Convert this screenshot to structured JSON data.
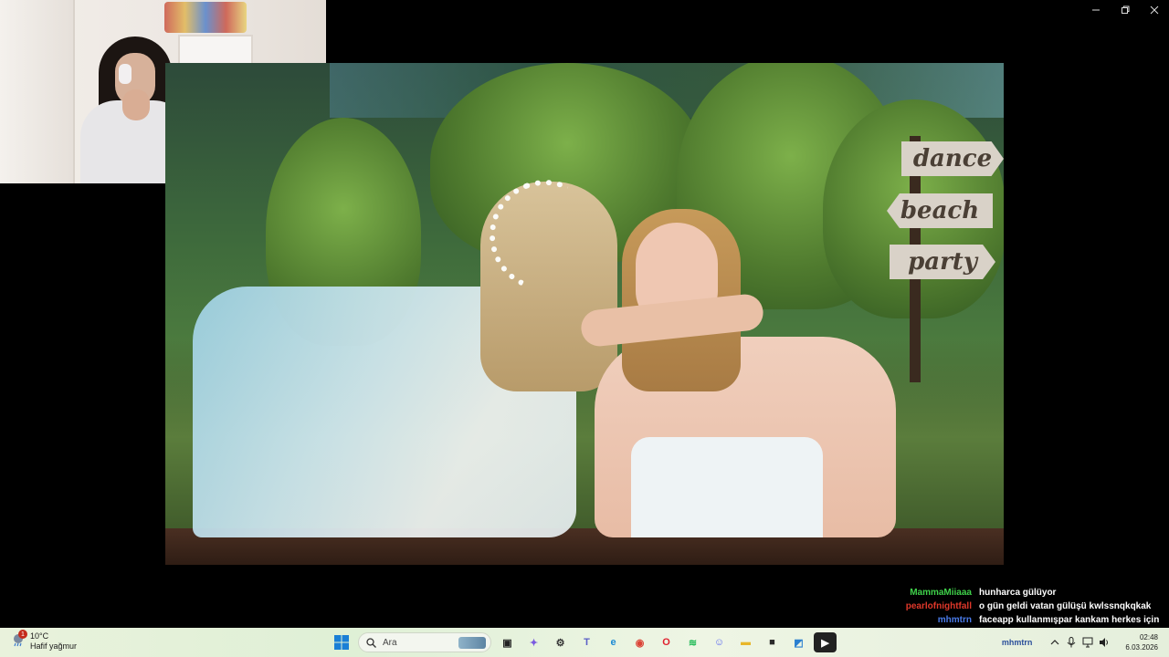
{
  "window": {
    "controls": [
      {
        "name": "minimize-icon"
      },
      {
        "name": "restore-icon"
      },
      {
        "name": "close-icon"
      }
    ]
  },
  "video": {
    "signs": [
      "dance",
      "beach",
      "party"
    ]
  },
  "chat": {
    "messages": [
      {
        "user": "MammaMiiaaa",
        "color": "#3fd14a",
        "text": "hunharca gülüyor"
      },
      {
        "user": "pearlofnightfall",
        "color": "#e0382a",
        "text": "o gün geldi vatan gülüşü kwlssnqkqkak"
      },
      {
        "user": "mhmtrn",
        "color": "#4a7be8",
        "text": "faceapp kullanmışpar kankam herkes için"
      }
    ]
  },
  "taskbar": {
    "weather": {
      "temp": "10°C",
      "condition": "Hafif yağmur",
      "badge": "1"
    },
    "search": {
      "placeholder": "Ara"
    },
    "apps": [
      {
        "name": "task-view-icon",
        "glyph": "▣",
        "bg": "transparent",
        "fg": "#222"
      },
      {
        "name": "copilot-icon",
        "glyph": "✦",
        "bg": "transparent",
        "fg": "#7a5ae0"
      },
      {
        "name": "settings-icon",
        "glyph": "⚙",
        "bg": "transparent",
        "fg": "#333"
      },
      {
        "name": "teams-icon",
        "glyph": "T",
        "bg": "transparent",
        "fg": "#5b5fc7"
      },
      {
        "name": "edge-icon",
        "glyph": "e",
        "bg": "transparent",
        "fg": "#1a8ad4"
      },
      {
        "name": "chrome-icon",
        "glyph": "◉",
        "bg": "transparent",
        "fg": "#db4437"
      },
      {
        "name": "opera-icon",
        "glyph": "O",
        "bg": "transparent",
        "fg": "#e0202e"
      },
      {
        "name": "spotify-icon",
        "glyph": "≋",
        "bg": "transparent",
        "fg": "#1db954"
      },
      {
        "name": "discord-icon",
        "glyph": "☺",
        "bg": "transparent",
        "fg": "#5865f2"
      },
      {
        "name": "file-explorer-icon",
        "glyph": "▬",
        "bg": "transparent",
        "fg": "#e8b62a"
      },
      {
        "name": "terminal-icon",
        "glyph": "■",
        "bg": "transparent",
        "fg": "#2a2a2a"
      },
      {
        "name": "photos-icon",
        "glyph": "◩",
        "bg": "transparent",
        "fg": "#2a7fd0"
      },
      {
        "name": "media-player-icon",
        "glyph": "▶",
        "bg": "#222",
        "fg": "#fff"
      }
    ],
    "tray": {
      "ghost_user": "mhmtrn",
      "icons": [
        "chevron-up-icon",
        "microphone-icon",
        "network-icon",
        "volume-icon"
      ],
      "time": "02:48",
      "date": "6.03.2026"
    }
  }
}
